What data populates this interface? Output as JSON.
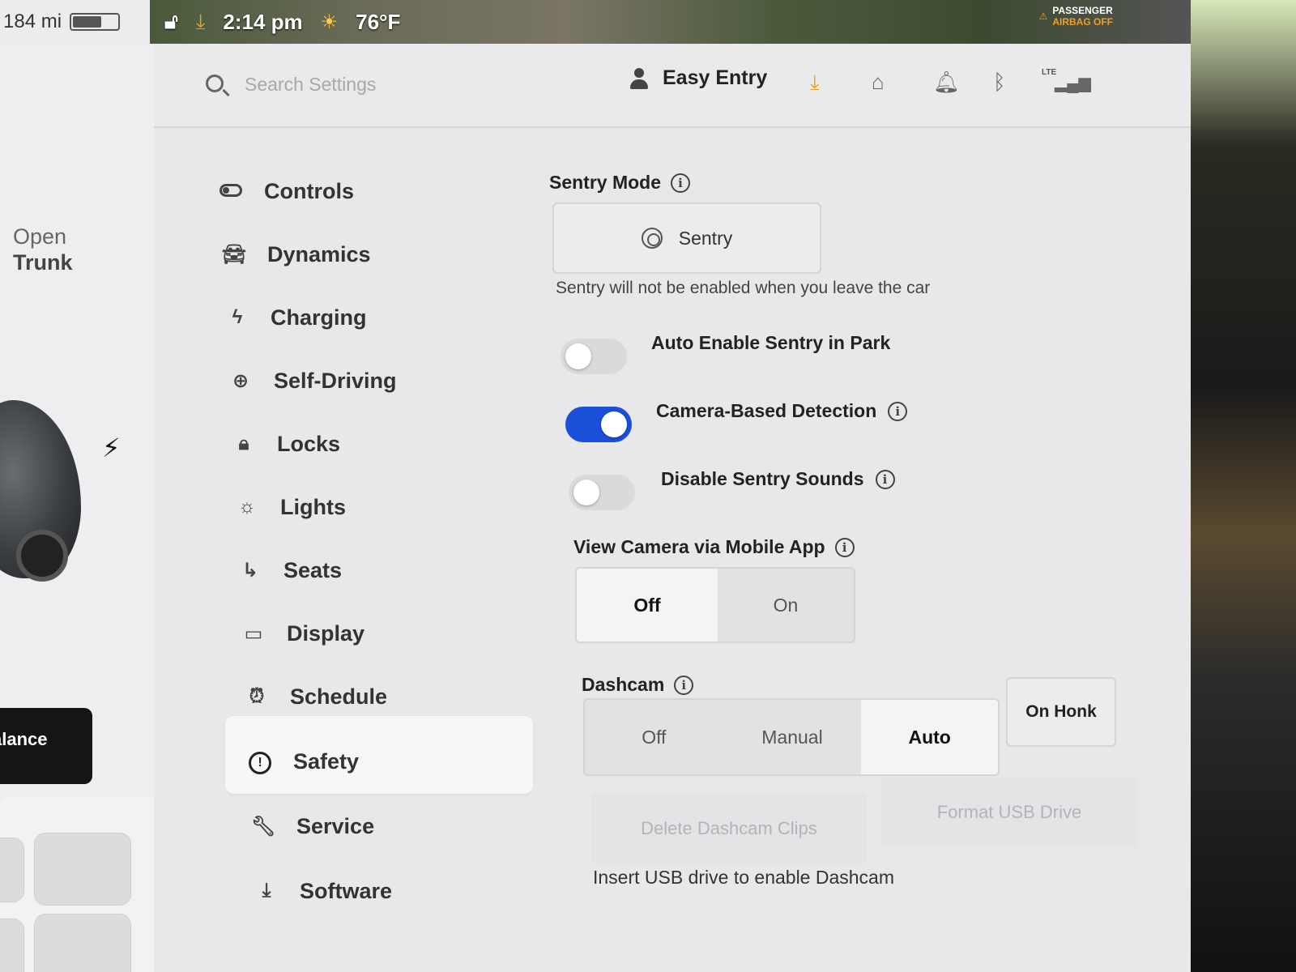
{
  "status": {
    "range": "184 mi",
    "time": "2:14 pm",
    "temperature": "76°F",
    "airbag_line1": "PASSENGER",
    "airbag_line2": "AIRBAG OFF"
  },
  "car": {
    "open_trunk_line1": "Open",
    "open_trunk_line2": "Trunk",
    "balance_label": "alance"
  },
  "header": {
    "search_placeholder": "Search Settings",
    "profile_name": "Easy Entry",
    "lte": "LTE"
  },
  "nav": {
    "items": [
      {
        "label": "Controls",
        "icon": "toggle-icon"
      },
      {
        "label": "Dynamics",
        "icon": "car-icon"
      },
      {
        "label": "Charging",
        "icon": "bolt-icon"
      },
      {
        "label": "Self-Driving",
        "icon": "steering-wheel-icon"
      },
      {
        "label": "Locks",
        "icon": "lock-icon"
      },
      {
        "label": "Lights",
        "icon": "light-icon"
      },
      {
        "label": "Seats",
        "icon": "seat-icon"
      },
      {
        "label": "Display",
        "icon": "display-icon"
      },
      {
        "label": "Schedule",
        "icon": "alarm-clock-icon"
      },
      {
        "label": "Safety",
        "icon": "alert-icon"
      },
      {
        "label": "Service",
        "icon": "wrench-icon"
      },
      {
        "label": "Software",
        "icon": "download-icon"
      }
    ],
    "selected": "Safety"
  },
  "sentry": {
    "title": "Sentry Mode",
    "button_label": "Sentry",
    "helper": "Sentry will not be enabled when you leave the car"
  },
  "toggles": [
    {
      "label": "Auto Enable Sentry in Park",
      "on": false
    },
    {
      "label": "Camera-Based Detection",
      "on": true
    },
    {
      "label": "Disable Sentry Sounds",
      "on": false
    }
  ],
  "mobile_camera": {
    "title": "View Camera via Mobile App",
    "options": [
      "Off",
      "On"
    ],
    "selected": "Off"
  },
  "dashcam": {
    "title": "Dashcam",
    "options": [
      "Off",
      "Manual",
      "Auto"
    ],
    "selected": "Auto",
    "on_honk": "On Honk",
    "delete_label": "Delete Dashcam Clips",
    "format_label": "Format USB Drive",
    "note": "Insert USB drive to enable Dashcam"
  },
  "colors": {
    "accent_blue": "#1a4fd8",
    "download_orange": "#f0a020"
  }
}
